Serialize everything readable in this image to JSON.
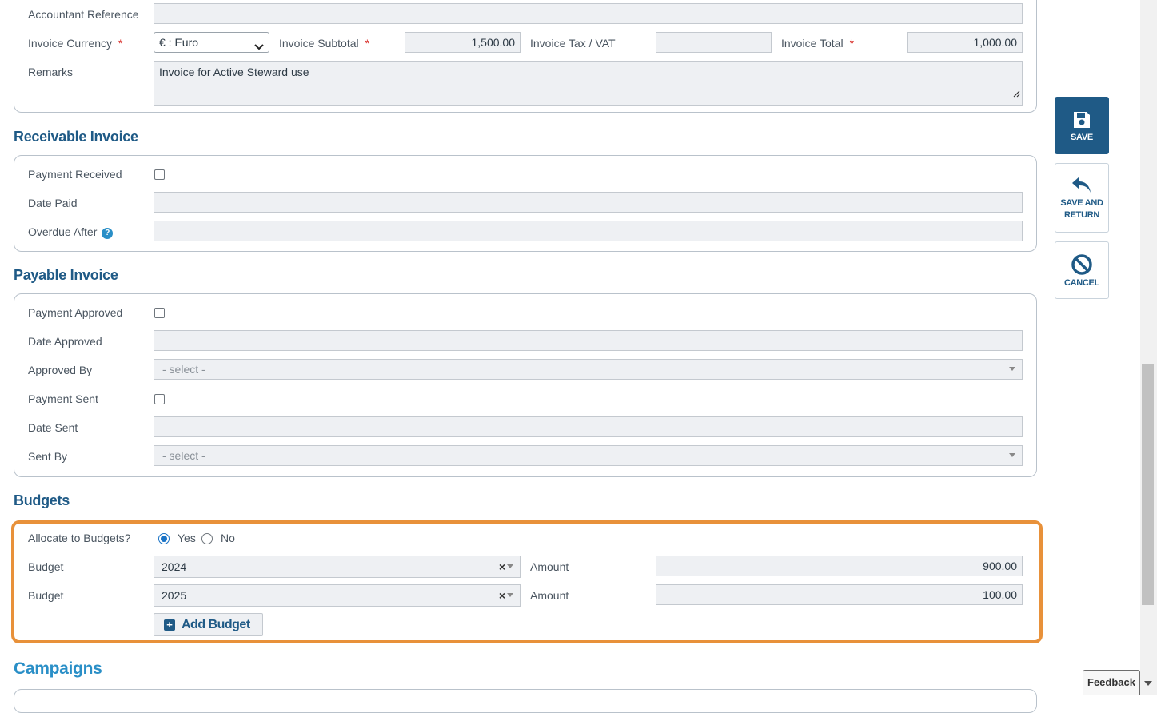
{
  "form": {
    "accountant_reference": {
      "label": "Accountant Reference",
      "value": ""
    },
    "invoice_currency": {
      "label": "Invoice Currency",
      "required": "*",
      "value": "€ : Euro"
    },
    "invoice_subtotal": {
      "label": "Invoice Subtotal",
      "required": "*",
      "value": "1,500.00"
    },
    "invoice_tax": {
      "label": "Invoice Tax / VAT",
      "value": ""
    },
    "invoice_total": {
      "label": "Invoice Total",
      "required": "*",
      "value": "1,000.00"
    },
    "remarks": {
      "label": "Remarks",
      "value": "Invoice for Active Steward use"
    }
  },
  "receivable": {
    "title": "Receivable Invoice",
    "payment_received": {
      "label": "Payment Received",
      "checked": false
    },
    "date_paid": {
      "label": "Date Paid",
      "value": ""
    },
    "overdue_after": {
      "label": "Overdue After",
      "help": "?",
      "value": ""
    }
  },
  "payable": {
    "title": "Payable Invoice",
    "payment_approved": {
      "label": "Payment Approved",
      "checked": false
    },
    "date_approved": {
      "label": "Date Approved",
      "value": ""
    },
    "approved_by": {
      "label": "Approved By",
      "placeholder": "- select -"
    },
    "payment_sent": {
      "label": "Payment Sent",
      "checked": false
    },
    "date_sent": {
      "label": "Date Sent",
      "value": ""
    },
    "sent_by": {
      "label": "Sent By",
      "placeholder": "- select -"
    }
  },
  "budgets": {
    "title": "Budgets",
    "allocate": {
      "label": "Allocate to Budgets?",
      "yes": "Yes",
      "no": "No",
      "selected": "Yes"
    },
    "rows": [
      {
        "label": "Budget",
        "budget": "2024",
        "clear": "×",
        "amount_label": "Amount",
        "amount": "900.00"
      },
      {
        "label": "Budget",
        "budget": "2025",
        "clear": "×",
        "amount_label": "Amount",
        "amount": "100.00"
      }
    ],
    "add_label": "Add Budget",
    "add_icon": "+",
    "highlight_color": "#e8913a"
  },
  "campaigns": {
    "title": "Campaigns"
  },
  "actions": {
    "save": "SAVE",
    "save_return_line1": "SAVE AND",
    "save_return_line2": "RETURN",
    "cancel": "CANCEL"
  },
  "feedback": {
    "label": "Feedback"
  },
  "colors": {
    "brand": "#1f5a86",
    "required": "#d9302b",
    "field_bg": "#eef0f3"
  }
}
